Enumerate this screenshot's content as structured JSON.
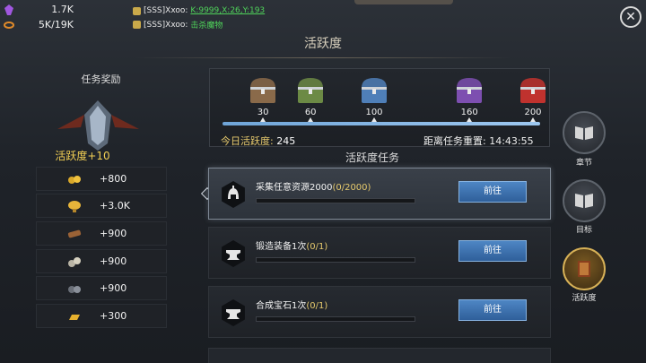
{
  "resources": [
    {
      "icon": "purple-crystal-icon",
      "value": "1.7K"
    },
    {
      "icon": "energy-ring-icon",
      "value": "5K/19K"
    }
  ],
  "chat": [
    {
      "name": "[SSS]Xxoo:",
      "link": "K:9999,X:26,Y:193",
      "message": ""
    },
    {
      "name": "[SSS]Xxoo:",
      "link": "",
      "message": "击杀魔物"
    }
  ],
  "header": {
    "title": "活跃度"
  },
  "left_panel": {
    "title": "任务奖励",
    "points_label": "活跃度+10",
    "rewards": [
      {
        "icon": "gold-ore-icon",
        "value": "+800"
      },
      {
        "icon": "food-bowl-icon",
        "value": "+3.0K"
      },
      {
        "icon": "wood-icon",
        "value": "+900"
      },
      {
        "icon": "stone-icon",
        "value": "+900"
      },
      {
        "icon": "iron-ore-icon",
        "value": "+900"
      },
      {
        "icon": "gold-bar-icon",
        "value": "+300"
      }
    ]
  },
  "progress": {
    "milestones": [
      {
        "value": "30",
        "chest": "bronze-chest-icon",
        "color": "#8a6a4a"
      },
      {
        "value": "60",
        "chest": "green-chest-icon",
        "color": "#6c8a45"
      },
      {
        "value": "100",
        "chest": "blue-chest-icon",
        "color": "#4f7fb8"
      },
      {
        "value": "160",
        "chest": "purple-chest-icon",
        "color": "#7d4fb0"
      },
      {
        "value": "200",
        "chest": "red-chest-icon",
        "color": "#c0322e"
      }
    ],
    "fill_fraction": 1.0,
    "today_label": "今日活跃度:",
    "today_value": "245",
    "reset_label": "距离任务重置:",
    "reset_time": "14:43:55"
  },
  "tasks_section": {
    "title": "活跃度任务"
  },
  "tasks": [
    {
      "icon": "spartan-helmet-icon",
      "name": "采集任意资源2000",
      "progress": "(0/2000)",
      "fraction": 0,
      "button": "前往",
      "selected": true
    },
    {
      "icon": "anvil-icon",
      "name": "锻造装备1次",
      "progress": "(0/1)",
      "fraction": 0,
      "button": "前往",
      "selected": false
    },
    {
      "icon": "anvil-icon",
      "name": "合成宝石1次",
      "progress": "(0/1)",
      "fraction": 0,
      "button": "前往",
      "selected": false
    }
  ],
  "nav": [
    {
      "label": "章节",
      "icon": "chapter-book-icon",
      "active": false
    },
    {
      "label": "目标",
      "icon": "goal-book-icon",
      "active": false
    },
    {
      "label": "活跃度",
      "icon": "activity-book-icon",
      "active": true
    }
  ]
}
